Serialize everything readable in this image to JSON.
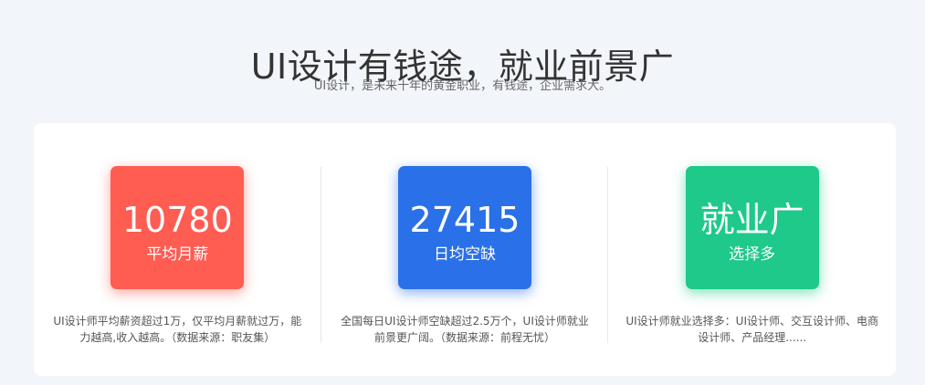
{
  "header": {
    "title": "UI设计有钱途，就业前景广",
    "subtitle": "UI设计，是未来十年的黄金职业，有钱途，企业需求大。"
  },
  "stats": [
    {
      "value": "10780",
      "label": "平均月薪",
      "color": "#ff5c52",
      "desc": "UI设计师平均薪资超过1万，仅平均月薪就过万，能力越高,收入越高。（数据来源：职友集）"
    },
    {
      "value": "27415",
      "label": "日均空缺",
      "color": "#2a70e8",
      "desc": "全国每日UI设计师空缺超过2.5万个，UI设计师就业前景更广阔。（数据来源：前程无忧）"
    },
    {
      "value": "就业广",
      "label": "选择多",
      "color": "#1ec98a",
      "desc": "UI设计师就业选择多：UI设计师、交互设计师、电商设计师、产品经理......"
    }
  ]
}
